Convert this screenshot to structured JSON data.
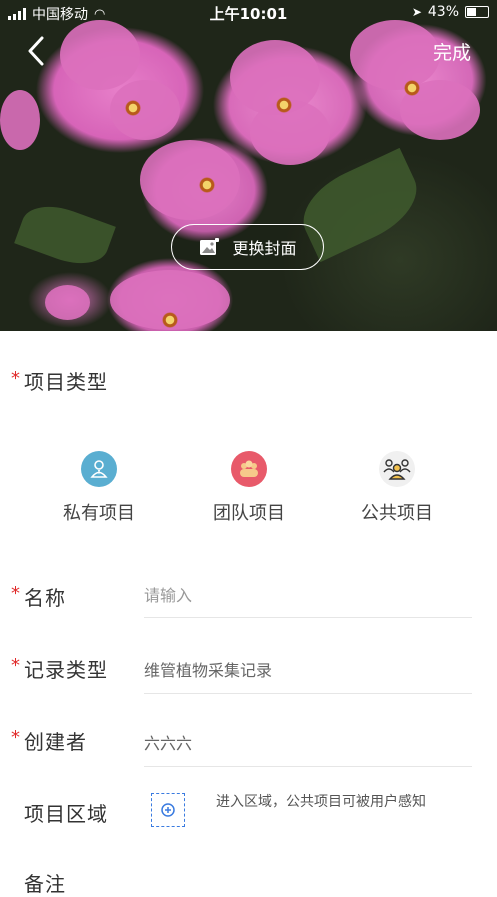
{
  "status": {
    "carrier": "中国移动",
    "time": "上午10:01",
    "battery": "43%"
  },
  "header": {
    "back_icon": "chevron-left-icon",
    "done_label": "完成",
    "change_cover_label": "更换封面",
    "change_cover_icon": "image-icon"
  },
  "form": {
    "project_type_label": "项目类型",
    "project_types": [
      {
        "label": "私有项目",
        "icon": "private-user-icon",
        "color": "#5aaed1"
      },
      {
        "label": "团队项目",
        "icon": "team-icon",
        "color": "#e85a6a"
      },
      {
        "label": "公共项目",
        "icon": "public-group-icon",
        "color": "#f0f0f0"
      }
    ],
    "name": {
      "label": "名称",
      "placeholder": "请输入"
    },
    "record_type": {
      "label": "记录类型",
      "value": "维管植物采集记录"
    },
    "creator": {
      "label": "创建者",
      "value": "六六六"
    },
    "area": {
      "label": "项目区域",
      "hint": "进入区域，公共项目可被用户感知"
    },
    "notes": {
      "label": "备注"
    }
  },
  "colors": {
    "required": "#e02a2a",
    "area_border": "#3a7be0"
  }
}
